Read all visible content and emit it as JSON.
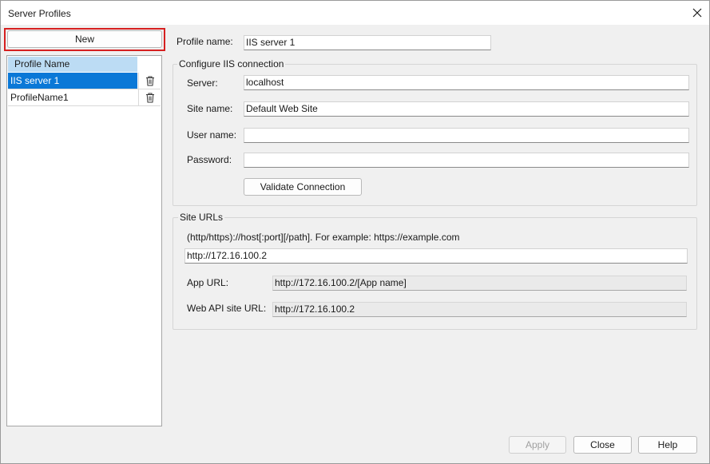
{
  "window": {
    "title": "Server Profiles"
  },
  "profiles": {
    "new_label": "New",
    "column_header": "Profile Name",
    "items": [
      {
        "name": "IIS server 1",
        "selected": true
      },
      {
        "name": "ProfileName1",
        "selected": false
      }
    ]
  },
  "profile": {
    "name_label": "Profile name:",
    "name_value": "IIS server 1"
  },
  "iis": {
    "group_title": "Configure IIS connection",
    "server_label": "Server:",
    "server_value": "localhost",
    "site_label": "Site name:",
    "site_value": "Default Web Site",
    "user_label": "User name:",
    "user_value": "",
    "password_label": "Password:",
    "password_value": "",
    "validate_label": "Validate Connection"
  },
  "urls": {
    "group_title": "Site URLs",
    "hint": "(http/https)://host[:port][/path].  For example: https://example.com",
    "base_value": "http://172.16.100.2",
    "app_label": "App URL:",
    "app_value": "http://172.16.100.2/[App name]",
    "webapi_label": "Web API site URL:",
    "webapi_value": "http://172.16.100.2"
  },
  "footer": {
    "apply_label": "Apply",
    "close_label": "Close",
    "help_label": "Help"
  },
  "colors": {
    "selection": "#0a78d7",
    "header": "#bcdcf4",
    "highlight_outline": "#d62020"
  }
}
